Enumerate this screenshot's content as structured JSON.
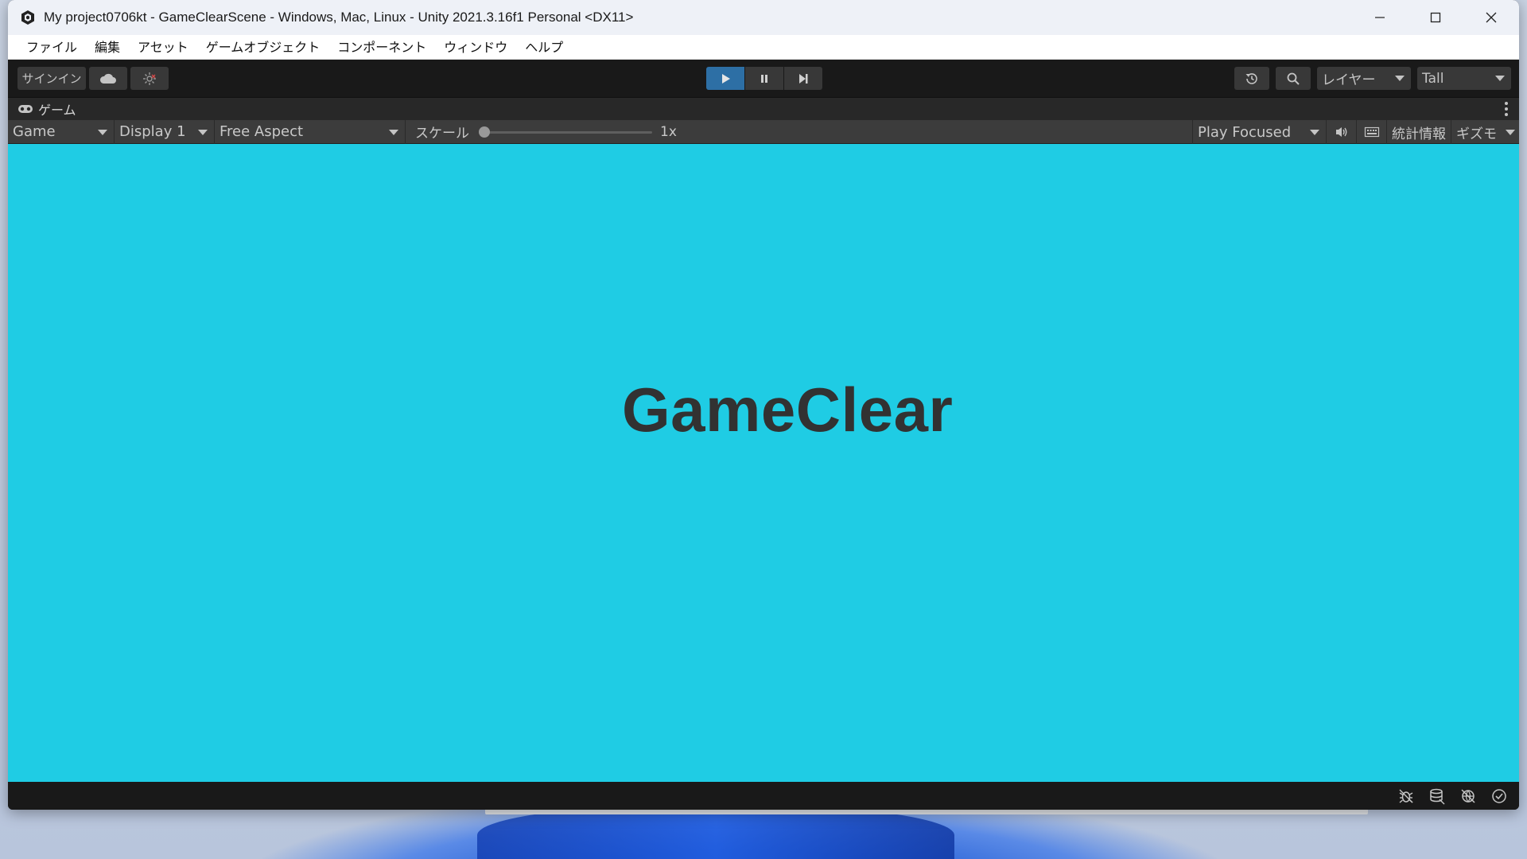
{
  "window": {
    "title": "My project0706kt - GameClearScene - Windows, Mac, Linux - Unity 2021.3.16f1 Personal <DX11>"
  },
  "menu": {
    "items": [
      "ファイル",
      "編集",
      "アセット",
      "ゲームオブジェクト",
      "コンポーネント",
      "ウィンドウ",
      "ヘルプ"
    ]
  },
  "toolbar": {
    "signin_label": "サインイン",
    "layers_label": "レイヤー",
    "layout_label": "Tall"
  },
  "tab": {
    "label": "ゲーム"
  },
  "gamebar": {
    "view_mode": "Game",
    "display": "Display 1",
    "aspect": "Free Aspect",
    "scale_label": "スケール",
    "scale_value": "1x",
    "scale_fraction": 0.0,
    "play_mode": "Play Focused",
    "stats_label": "統計情報",
    "gizmos_label": "ギズモ"
  },
  "game": {
    "text": "GameClear",
    "background_color": "#1fcce4",
    "text_color": "#323232"
  },
  "colors": {
    "play_active": "#2d6fa5",
    "editor_bg": "#191919"
  }
}
